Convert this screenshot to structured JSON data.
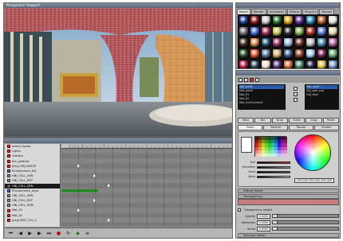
{
  "viewport": {
    "title": "Perspective Viewport"
  },
  "dopesheet": {
    "title": "",
    "tree": [
      {
        "label": "scene_layout",
        "icon": "red",
        "selected": false
      },
      {
        "label": "Lights",
        "icon": "red",
        "selected": false
      },
      {
        "label": "Camera",
        "icon": "red",
        "selected": false
      },
      {
        "label": "dcs_position",
        "icon": "red",
        "selected": false
      },
      {
        "label": "[key] OBJ_MAT05",
        "icon": "red",
        "selected": false
      },
      {
        "label": "Environment_Set",
        "icon": "blue",
        "selected": false
      },
      {
        "label": "OBJ_CELL_GEN",
        "icon": "gray",
        "selected": false
      },
      {
        "label": "OBJ_CELL_EXP",
        "icon": "gray",
        "selected": false
      },
      {
        "label": "OBJ_CELL_GEN",
        "icon": "gray",
        "selected": true
      },
      {
        "label": "Environment_layer",
        "icon": "blue",
        "selected": false
      },
      {
        "label": "OBJ_CELL_GEN",
        "icon": "gray",
        "selected": false
      },
      {
        "label": "OBJ_CELL_EXP",
        "icon": "gray",
        "selected": false
      },
      {
        "label": "OBJ_CELL_SOM",
        "icon": "gray",
        "selected": false
      },
      {
        "label": "Mat_01",
        "icon": "red",
        "selected": false
      },
      {
        "label": "Mat_02",
        "icon": "red",
        "selected": false
      },
      {
        "label": "[key] MAT_COL_C",
        "icon": "red",
        "selected": false
      }
    ],
    "keyframe_color": "#1f8a1f",
    "footer_controls": [
      {
        "name": "go-start-icon",
        "glyph": "⏮"
      },
      {
        "name": "step-back-icon",
        "glyph": "◀"
      },
      {
        "name": "play-icon",
        "glyph": "▶"
      },
      {
        "name": "step-forward-icon",
        "glyph": "▶"
      },
      {
        "name": "go-end-icon",
        "glyph": "⏭"
      },
      {
        "name": "record-icon",
        "glyph": "●"
      },
      {
        "name": "loop-icon",
        "glyph": "↻"
      },
      {
        "name": "key-icon",
        "glyph": "◆"
      },
      {
        "name": "options-icon",
        "glyph": "≡"
      }
    ]
  },
  "browser": {
    "title": "",
    "tabs": [
      "Model",
      "Render",
      "Animation",
      "Effects",
      "Plug-ins",
      "Movies"
    ],
    "active_tab": 0
  },
  "editor": {
    "title": "",
    "materials": [
      "Mat_wall1",
      "Mat_wall2",
      "Mat_fl1",
      "Mat_fl2",
      "Mat_environment"
    ],
    "selected_material": 0,
    "tree": [
      "Mat_wall1",
      "Obj_wall_sub",
      "Obj_floor"
    ],
    "buttons": [
      "New",
      "Del",
      "Dupl",
      "Clean",
      "Copy",
      "Paste"
    ],
    "tabs": [
      "Color",
      "Texture",
      "Transp.",
      "Shader"
    ],
    "sliders": [
      {
        "label": "Hue",
        "color": "#cc3333"
      },
      {
        "label": "Saturation",
        "color": "#a0a0a0"
      },
      {
        "label": "Value",
        "color": "#5a5a5a"
      },
      {
        "label": "Alpha",
        "color": "#d0d0d0"
      }
    ],
    "rgb_readout": "255.000 255.000 255.000",
    "section1": "Diffuse Model",
    "section2": "Transparency",
    "transparency_toggle": "Transparency enable",
    "params": [
      {
        "label": "Opacity",
        "value": "0.0000"
      },
      {
        "label": "Refraction",
        "value": "0.0000"
      },
      {
        "label": "Bump",
        "value": "0.0000"
      }
    ],
    "section3": "Specular Model",
    "accent_red": "#c97c7c"
  }
}
